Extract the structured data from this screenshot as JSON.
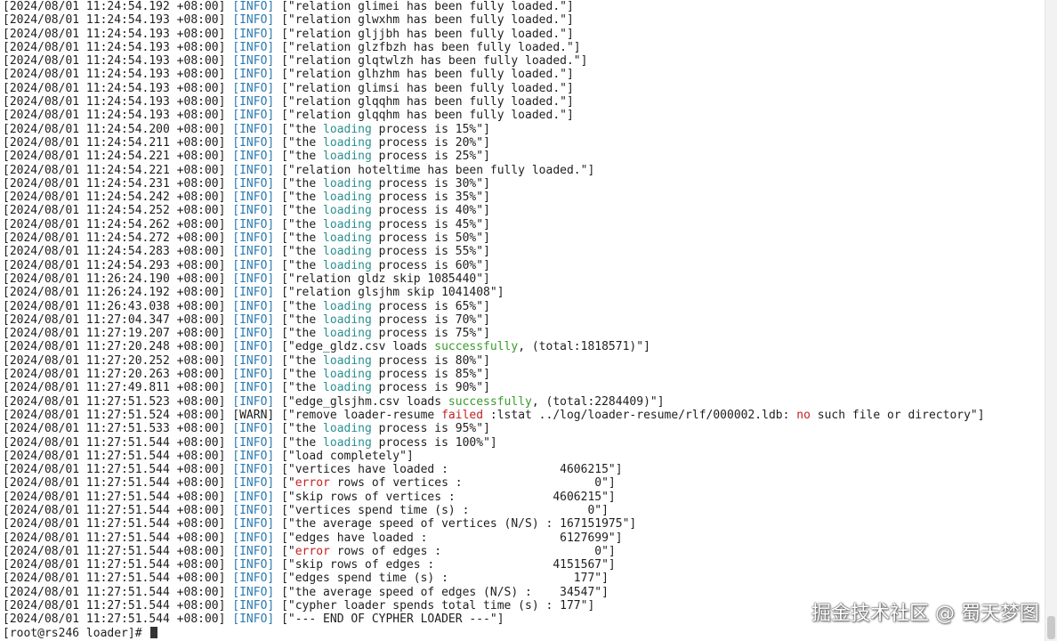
{
  "log": [
    {
      "ts": "[2024/08/01 11:24:54.192 +08:00]",
      "level": "[INFO]",
      "parts": [
        {
          "t": " [\"relation glimei has been fully loaded.\"]"
        }
      ]
    },
    {
      "ts": "[2024/08/01 11:24:54.193 +08:00]",
      "level": "[INFO]",
      "parts": [
        {
          "t": " [\"relation glwxhm has been fully loaded.\"]"
        }
      ]
    },
    {
      "ts": "[2024/08/01 11:24:54.193 +08:00]",
      "level": "[INFO]",
      "parts": [
        {
          "t": " [\"relation gljjbh has been fully loaded.\"]"
        }
      ]
    },
    {
      "ts": "[2024/08/01 11:24:54.193 +08:00]",
      "level": "[INFO]",
      "parts": [
        {
          "t": " [\"relation glzfbzh has been fully loaded.\"]"
        }
      ]
    },
    {
      "ts": "[2024/08/01 11:24:54.193 +08:00]",
      "level": "[INFO]",
      "parts": [
        {
          "t": " [\"relation glqtwlzh has been fully loaded.\"]"
        }
      ]
    },
    {
      "ts": "[2024/08/01 11:24:54.193 +08:00]",
      "level": "[INFO]",
      "parts": [
        {
          "t": " [\"relation glhzhm has been fully loaded.\"]"
        }
      ]
    },
    {
      "ts": "[2024/08/01 11:24:54.193 +08:00]",
      "level": "[INFO]",
      "parts": [
        {
          "t": " [\"relation glimsi has been fully loaded.\"]"
        }
      ]
    },
    {
      "ts": "[2024/08/01 11:24:54.193 +08:00]",
      "level": "[INFO]",
      "parts": [
        {
          "t": " [\"relation glqqhm has been fully loaded.\"]"
        }
      ]
    },
    {
      "ts": "[2024/08/01 11:24:54.193 +08:00]",
      "level": "[INFO]",
      "parts": [
        {
          "t": " [\"relation glqqhm has been fully loaded.\"]"
        }
      ]
    },
    {
      "ts": "[2024/08/01 11:24:54.200 +08:00]",
      "level": "[INFO]",
      "parts": [
        {
          "t": " [\"the "
        },
        {
          "t": "loading",
          "c": "hl-loading"
        },
        {
          "t": " process is 15%\"]"
        }
      ]
    },
    {
      "ts": "[2024/08/01 11:24:54.211 +08:00]",
      "level": "[INFO]",
      "parts": [
        {
          "t": " [\"the "
        },
        {
          "t": "loading",
          "c": "hl-loading"
        },
        {
          "t": " process is 20%\"]"
        }
      ]
    },
    {
      "ts": "[2024/08/01 11:24:54.221 +08:00]",
      "level": "[INFO]",
      "parts": [
        {
          "t": " [\"the "
        },
        {
          "t": "loading",
          "c": "hl-loading"
        },
        {
          "t": " process is 25%\"]"
        }
      ]
    },
    {
      "ts": "[2024/08/01 11:24:54.221 +08:00]",
      "level": "[INFO]",
      "parts": [
        {
          "t": " [\"relation hoteltime has been fully loaded.\"]"
        }
      ]
    },
    {
      "ts": "[2024/08/01 11:24:54.231 +08:00]",
      "level": "[INFO]",
      "parts": [
        {
          "t": " [\"the "
        },
        {
          "t": "loading",
          "c": "hl-loading"
        },
        {
          "t": " process is 30%\"]"
        }
      ]
    },
    {
      "ts": "[2024/08/01 11:24:54.242 +08:00]",
      "level": "[INFO]",
      "parts": [
        {
          "t": " [\"the "
        },
        {
          "t": "loading",
          "c": "hl-loading"
        },
        {
          "t": " process is 35%\"]"
        }
      ]
    },
    {
      "ts": "[2024/08/01 11:24:54.252 +08:00]",
      "level": "[INFO]",
      "parts": [
        {
          "t": " [\"the "
        },
        {
          "t": "loading",
          "c": "hl-loading"
        },
        {
          "t": " process is 40%\"]"
        }
      ]
    },
    {
      "ts": "[2024/08/01 11:24:54.262 +08:00]",
      "level": "[INFO]",
      "parts": [
        {
          "t": " [\"the "
        },
        {
          "t": "loading",
          "c": "hl-loading"
        },
        {
          "t": " process is 45%\"]"
        }
      ]
    },
    {
      "ts": "[2024/08/01 11:24:54.272 +08:00]",
      "level": "[INFO]",
      "parts": [
        {
          "t": " [\"the "
        },
        {
          "t": "loading",
          "c": "hl-loading"
        },
        {
          "t": " process is 50%\"]"
        }
      ]
    },
    {
      "ts": "[2024/08/01 11:24:54.283 +08:00]",
      "level": "[INFO]",
      "parts": [
        {
          "t": " [\"the "
        },
        {
          "t": "loading",
          "c": "hl-loading"
        },
        {
          "t": " process is 55%\"]"
        }
      ]
    },
    {
      "ts": "[2024/08/01 11:24:54.293 +08:00]",
      "level": "[INFO]",
      "parts": [
        {
          "t": " [\"the "
        },
        {
          "t": "loading",
          "c": "hl-loading"
        },
        {
          "t": " process is 60%\"]"
        }
      ]
    },
    {
      "ts": "[2024/08/01 11:26:24.190 +08:00]",
      "level": "[INFO]",
      "parts": [
        {
          "t": " [\"relation gldz skip 1085440\"]"
        }
      ]
    },
    {
      "ts": "[2024/08/01 11:26:24.192 +08:00]",
      "level": "[INFO]",
      "parts": [
        {
          "t": " [\"relation glsjhm skip 1041408\"]"
        }
      ]
    },
    {
      "ts": "[2024/08/01 11:26:43.038 +08:00]",
      "level": "[INFO]",
      "parts": [
        {
          "t": " [\"the "
        },
        {
          "t": "loading",
          "c": "hl-loading"
        },
        {
          "t": " process is 65%\"]"
        }
      ]
    },
    {
      "ts": "[2024/08/01 11:27:04.347 +08:00]",
      "level": "[INFO]",
      "parts": [
        {
          "t": " [\"the "
        },
        {
          "t": "loading",
          "c": "hl-loading"
        },
        {
          "t": " process is 70%\"]"
        }
      ]
    },
    {
      "ts": "[2024/08/01 11:27:19.207 +08:00]",
      "level": "[INFO]",
      "parts": [
        {
          "t": " [\"the "
        },
        {
          "t": "loading",
          "c": "hl-loading"
        },
        {
          "t": " process is 75%\"]"
        }
      ]
    },
    {
      "ts": "[2024/08/01 11:27:20.248 +08:00]",
      "level": "[INFO]",
      "parts": [
        {
          "t": " [\"edge_gldz.csv loads "
        },
        {
          "t": "successfully",
          "c": "hl-success"
        },
        {
          "t": ", (total:1818571)\"]"
        }
      ]
    },
    {
      "ts": "[2024/08/01 11:27:20.252 +08:00]",
      "level": "[INFO]",
      "parts": [
        {
          "t": " [\"the "
        },
        {
          "t": "loading",
          "c": "hl-loading"
        },
        {
          "t": " process is 80%\"]"
        }
      ]
    },
    {
      "ts": "[2024/08/01 11:27:20.263 +08:00]",
      "level": "[INFO]",
      "parts": [
        {
          "t": " [\"the "
        },
        {
          "t": "loading",
          "c": "hl-loading"
        },
        {
          "t": " process is 85%\"]"
        }
      ]
    },
    {
      "ts": "[2024/08/01 11:27:49.811 +08:00]",
      "level": "[INFO]",
      "parts": [
        {
          "t": " [\"the "
        },
        {
          "t": "loading",
          "c": "hl-loading"
        },
        {
          "t": " process is 90%\"]"
        }
      ]
    },
    {
      "ts": "[2024/08/01 11:27:51.523 +08:00]",
      "level": "[INFO]",
      "parts": [
        {
          "t": " [\"edge_glsjhm.csv loads "
        },
        {
          "t": "successfully",
          "c": "hl-success"
        },
        {
          "t": ", (total:2284409)\"]"
        }
      ]
    },
    {
      "ts": "[2024/08/01 11:27:51.524 +08:00]",
      "level": "[WARN]",
      "parts": [
        {
          "t": " [\"remove loader-resume "
        },
        {
          "t": "failed",
          "c": "hl-failed"
        },
        {
          "t": " :lstat ../log/loader-resume/rlf/000002.ldb: "
        },
        {
          "t": "no",
          "c": "hl-no"
        },
        {
          "t": " such file or directory\"]"
        }
      ]
    },
    {
      "ts": "[2024/08/01 11:27:51.533 +08:00]",
      "level": "[INFO]",
      "parts": [
        {
          "t": " [\"the "
        },
        {
          "t": "loading",
          "c": "hl-loading"
        },
        {
          "t": " process is 95%\"]"
        }
      ]
    },
    {
      "ts": "[2024/08/01 11:27:51.544 +08:00]",
      "level": "[INFO]",
      "parts": [
        {
          "t": " [\"the "
        },
        {
          "t": "loading",
          "c": "hl-loading"
        },
        {
          "t": " process is 100%\"]"
        }
      ]
    },
    {
      "ts": "[2024/08/01 11:27:51.544 +08:00]",
      "level": "[INFO]",
      "parts": [
        {
          "t": " [\"load completely\"]"
        }
      ]
    },
    {
      "ts": "[2024/08/01 11:27:51.544 +08:00]",
      "level": "[INFO]",
      "parts": [
        {
          "t": " [\"vertices have loaded :                4606215\"]"
        }
      ]
    },
    {
      "ts": "[2024/08/01 11:27:51.544 +08:00]",
      "level": "[INFO]",
      "parts": [
        {
          "t": " [\""
        },
        {
          "t": "error",
          "c": "hl-error"
        },
        {
          "t": " rows of vertices :                   0\"]"
        }
      ]
    },
    {
      "ts": "[2024/08/01 11:27:51.544 +08:00]",
      "level": "[INFO]",
      "parts": [
        {
          "t": " [\"skip rows of vertices :              4606215\"]"
        }
      ]
    },
    {
      "ts": "[2024/08/01 11:27:51.544 +08:00]",
      "level": "[INFO]",
      "parts": [
        {
          "t": " [\"vertices spend time (s) :                 0\"]"
        }
      ]
    },
    {
      "ts": "[2024/08/01 11:27:51.544 +08:00]",
      "level": "[INFO]",
      "parts": [
        {
          "t": " [\"the average speed of vertices (N/S) : 167151975\"]"
        }
      ]
    },
    {
      "ts": "[2024/08/01 11:27:51.544 +08:00]",
      "level": "[INFO]",
      "parts": [
        {
          "t": " [\"edges have loaded :                   6127699\"]"
        }
      ]
    },
    {
      "ts": "[2024/08/01 11:27:51.544 +08:00]",
      "level": "[INFO]",
      "parts": [
        {
          "t": " [\""
        },
        {
          "t": "error",
          "c": "hl-error"
        },
        {
          "t": " rows of edges :                      0\"]"
        }
      ]
    },
    {
      "ts": "[2024/08/01 11:27:51.544 +08:00]",
      "level": "[INFO]",
      "parts": [
        {
          "t": " [\"skip rows of edges :                 4151567\"]"
        }
      ]
    },
    {
      "ts": "[2024/08/01 11:27:51.544 +08:00]",
      "level": "[INFO]",
      "parts": [
        {
          "t": " [\"edges spend time (s) :                  177\"]"
        }
      ]
    },
    {
      "ts": "[2024/08/01 11:27:51.544 +08:00]",
      "level": "[INFO]",
      "parts": [
        {
          "t": " [\"the average speed of edges (N/S) :    34547\"]"
        }
      ]
    },
    {
      "ts": "[2024/08/01 11:27:51.544 +08:00]",
      "level": "[INFO]",
      "parts": [
        {
          "t": " [\"cypher loader spends total time (s) : 177\"]"
        }
      ]
    },
    {
      "ts": "[2024/08/01 11:27:51.544 +08:00]",
      "level": "[INFO]",
      "parts": [
        {
          "t": " [\"--- END OF CYPHER LOADER ---\"]"
        }
      ]
    }
  ],
  "prompt": "[root@rs246 loader]# ",
  "watermark": "掘金技术社区 @ 蜀天梦图",
  "colors": {
    "info": "#2a7ab0",
    "loading": "#2a8f8f",
    "success": "#3a9a2c",
    "failed": "#c22222"
  }
}
